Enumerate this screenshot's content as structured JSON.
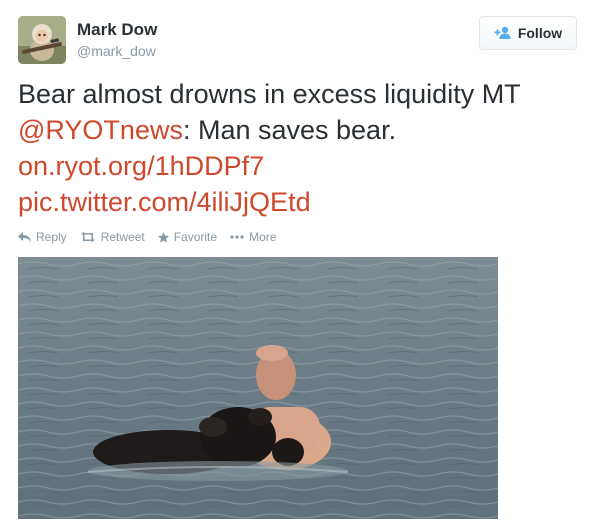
{
  "user": {
    "name": "Mark Dow",
    "handle": "@mark_dow",
    "avatar_icon": "monkey-with-rifle-avatar"
  },
  "follow_button": {
    "label": "Follow",
    "icon": "add-user-icon",
    "accent": "#55acee"
  },
  "tweet": {
    "line1": "Bear almost drowns in excess liquidity MT",
    "mention": "@RYOTnews",
    "line2_rest": ": Man saves bear.",
    "link1": "on.ryot.org/1hDDPf7",
    "link2": "pic.twitter.com/4iliJjQEtd",
    "link_color": "#d0482c"
  },
  "actions": {
    "reply": "Reply",
    "retweet": "Retweet",
    "favorite": "Favorite",
    "more": "More"
  },
  "photo": {
    "subject": "man-rescuing-bear-in-water-photo"
  }
}
